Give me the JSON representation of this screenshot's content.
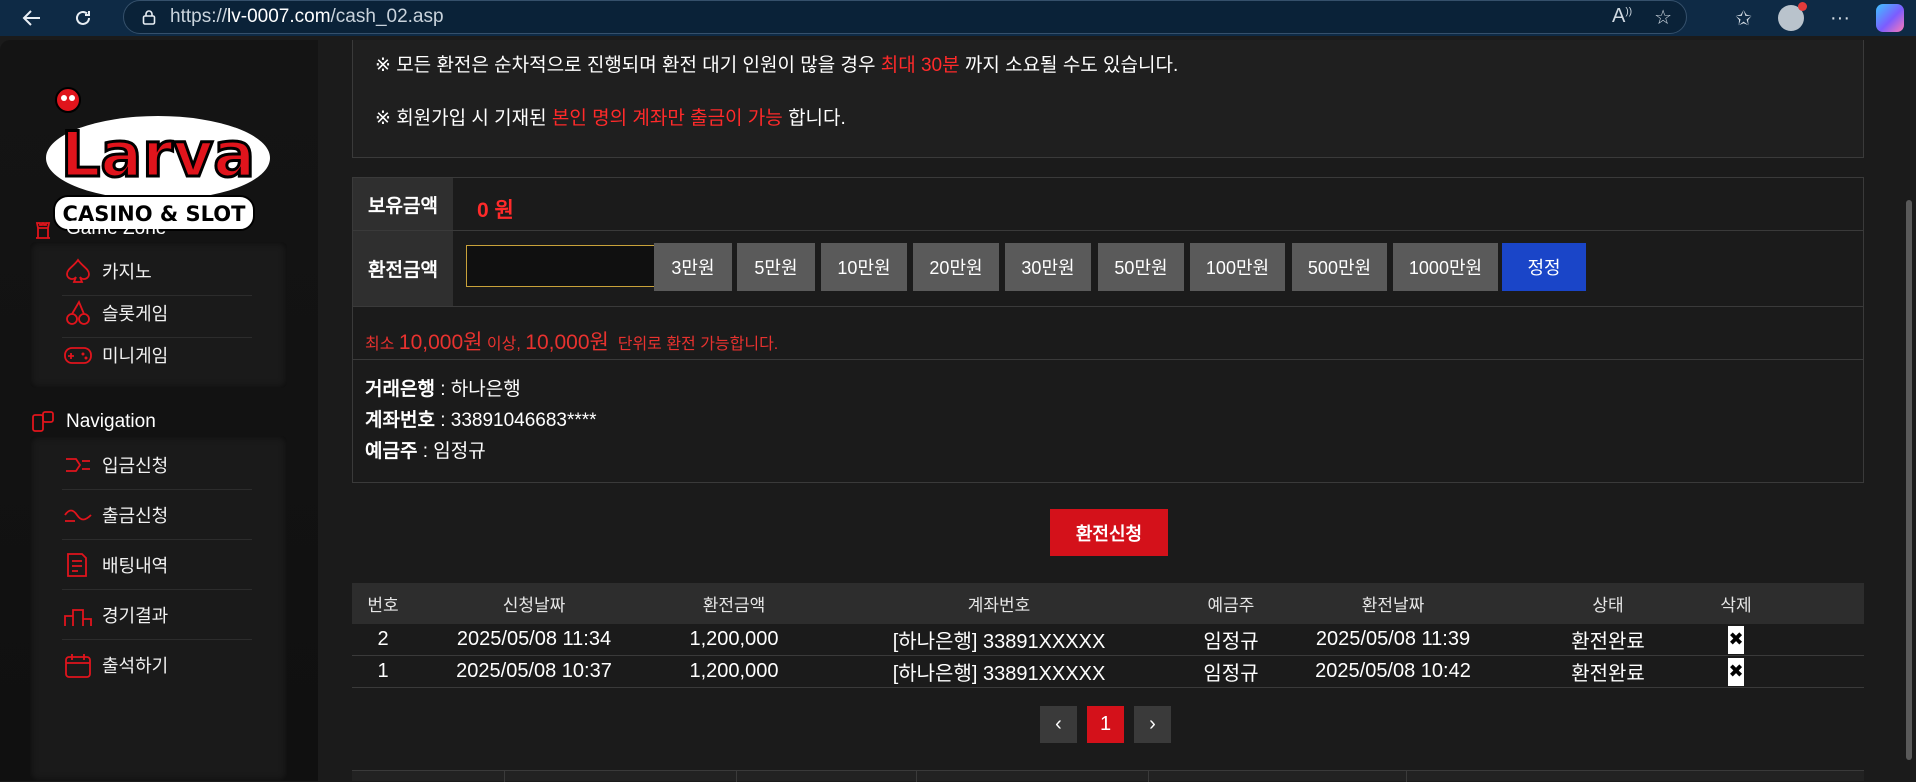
{
  "browser": {
    "url_prefix": "https://",
    "url_host": "lv-0007.com",
    "url_path": "/cash_02.asp"
  },
  "sidebar": {
    "logo_text": "Larva",
    "logo_sub": "CASINO & SLOT",
    "game_zone": {
      "title": "Game Zone",
      "items": [
        {
          "label": "카지노"
        },
        {
          "label": "슬롯게임"
        },
        {
          "label": "미니게임"
        }
      ]
    },
    "navigation": {
      "title": "Navigation",
      "items": [
        {
          "label": "입금신청"
        },
        {
          "label": "출금신청"
        },
        {
          "label": "배팅내역"
        },
        {
          "label": "경기결과"
        },
        {
          "label": "출석하기"
        }
      ]
    }
  },
  "notice": {
    "line1_a": "※ 모든 환전은 순차적으로 진행되며 환전 대기 인원이 많을 경우",
    "line1_red": "최대 30분",
    "line1_b": "까지 소요될 수도 있습니다.",
    "line2_a": "※ 회원가입 시 기재된",
    "line2_red": "본인 명의 계좌만 출금이 가능",
    "line2_b": "합니다."
  },
  "form": {
    "balance_label": "보유금액",
    "balance_value": "0 원",
    "amount_label": "환전금액",
    "amount_value": "",
    "amount_buttons": [
      "3만원",
      "5만원",
      "10만원",
      "20만원",
      "30만원",
      "50만원",
      "100만원",
      "500만원",
      "1000만원"
    ],
    "reset_label": "정정",
    "min_a": "최소",
    "min_amount": "10,000원",
    "min_b": "이상,",
    "unit_amount": "10,000원",
    "min_c": "단위로 환전 가능합니다.",
    "bank_label": "거래은행",
    "bank_value": " : 하나은행",
    "account_label": "계좌번호",
    "account_value": " : 33891046683****",
    "holder_label": "예금주",
    "holder_value": " : 임정규"
  },
  "submit_label": "환전신청",
  "table": {
    "headers": [
      "번호",
      "신청날짜",
      "환전금액",
      "계좌번호",
      "예금주",
      "환전날짜",
      "상태",
      "삭제"
    ],
    "rows": [
      [
        "2",
        "2025/05/08 11:34",
        "1,200,000",
        "[하나은행] 33891XXXXX",
        "임정규",
        "2025/05/08 11:39",
        "환전완료",
        "✖"
      ],
      [
        "1",
        "2025/05/08 10:37",
        "1,200,000",
        "[하나은행] 33891XXXXX",
        "임정규",
        "2025/05/08 10:42",
        "환전완료",
        "✖"
      ]
    ]
  },
  "pager": {
    "prev": "‹",
    "current": "1",
    "next": "›"
  },
  "colors": {
    "accent_red": "#d4111a",
    "text_red": "#ff2a2a",
    "blue_button": "#1a45c8",
    "chrome_bg": "#0e2a45"
  }
}
